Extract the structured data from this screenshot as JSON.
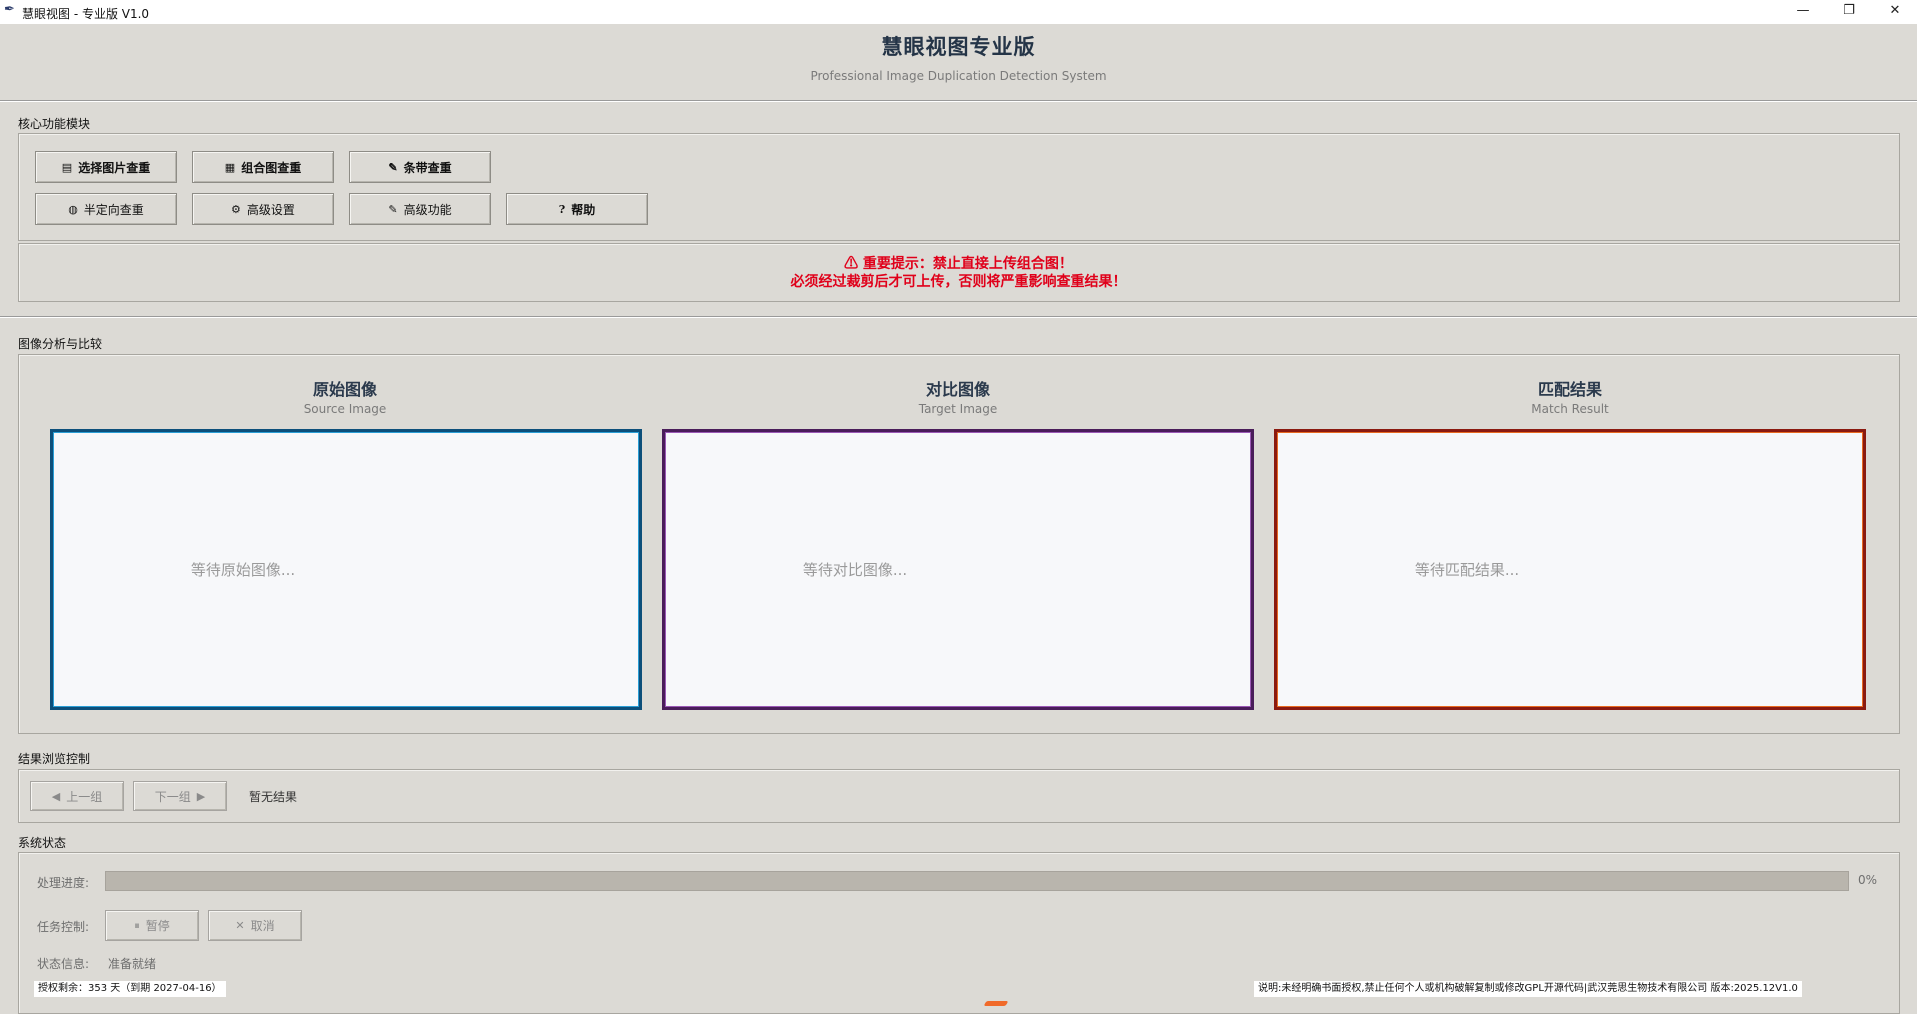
{
  "window": {
    "title": "慧眼视图 - 专业版 V1.0",
    "icon": "feather-icon",
    "minimize_glyph": "—",
    "maximize_glyph": "❐",
    "close_glyph": "✕"
  },
  "header": {
    "title": "慧眼视图专业版",
    "subtitle": "Professional Image Duplication Detection System"
  },
  "core": {
    "label": "核心功能模块",
    "buttons": [
      {
        "label": "选择图片查重",
        "icon": "▤"
      },
      {
        "label": "组合图查重",
        "icon": "▦"
      },
      {
        "label": "条带查重",
        "icon": "✎"
      },
      {
        "label": "半定向查重",
        "icon": "◍"
      },
      {
        "label": "高级设置",
        "icon": "⚙"
      },
      {
        "label": "高级功能",
        "icon": "✎"
      },
      {
        "label": "帮助",
        "icon": "?"
      }
    ],
    "warning_line1": "⚠    重要提示：禁止直接上传组合图！",
    "warning_line2": "必须经过裁剪后才可上传，否则将严重影响查重结果！",
    "warning_color": "#e0001a"
  },
  "analysis": {
    "label": "图像分析与比较",
    "panels": [
      {
        "title": "原始图像",
        "subtitle": "Source Image",
        "placeholder": "等待原始图像..."
      },
      {
        "title": "对比图像",
        "subtitle": "Target Image",
        "placeholder": "等待对比图像..."
      },
      {
        "title": "匹配结果",
        "subtitle": "Match Result",
        "placeholder": "等待匹配结果..."
      }
    ],
    "colors": {
      "source": "#2a9fd6",
      "target": "#9b59b6",
      "match": "#e86a20"
    }
  },
  "browse": {
    "label": "结果浏览控制",
    "prev_label": "上一组",
    "prev_icon": "◀",
    "next_label": "下一组",
    "next_icon": "▶",
    "status": "暂无结果"
  },
  "system": {
    "label": "系统状态",
    "progress_label": "处理进度:",
    "progress": 0,
    "progress_text": "0%",
    "task_label": "任务控制:",
    "pause_label": "暂停",
    "pause_icon": "⏸",
    "cancel_label": "取消",
    "cancel_icon": "✕",
    "status_label": "状态信息:",
    "status_value": "准备就绪"
  },
  "footer": {
    "license": "授权剩余：353 天（到期 2027-04-16）",
    "notice": "说明:未经明确书面授权,禁止任何个人或机构破解复制或修改GPL开源代码|武汉莞思生物技术有限公司 版本:2025.12V1.0"
  }
}
